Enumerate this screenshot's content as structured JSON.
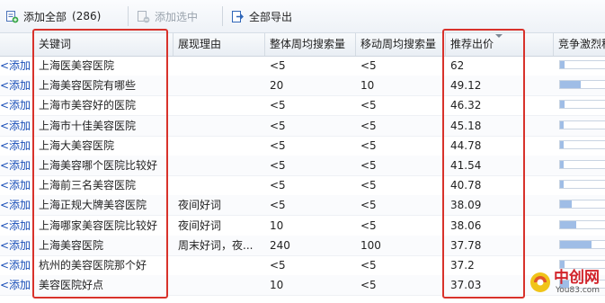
{
  "toolbar": {
    "add_all_label": "添加全部",
    "add_all_count": "(286)",
    "add_selected_label": "添加选中",
    "export_all_label": "全部导出"
  },
  "columns": {
    "keyword": "关键词",
    "reason": "展现理由",
    "overall_search": "整体周均搜索量",
    "mobile_search": "移动周均搜索量",
    "bid": "推荐出价",
    "competition": "竞争激烈程"
  },
  "add_link_text": "<添加",
  "rows": [
    {
      "keyword": "上海医美容医院",
      "reason": "",
      "overall": "<5",
      "mobile": "<5",
      "bid": "62",
      "competition": 0.1
    },
    {
      "keyword": "上海美容医院有哪些",
      "reason": "",
      "overall": "20",
      "mobile": "10",
      "bid": "49.12",
      "competition": 0.45
    },
    {
      "keyword": "上海市美容好的医院",
      "reason": "",
      "overall": "<5",
      "mobile": "<5",
      "bid": "46.32",
      "competition": 0.1
    },
    {
      "keyword": "上海市十佳美容医院",
      "reason": "",
      "overall": "<5",
      "mobile": "<5",
      "bid": "45.18",
      "competition": 0.08
    },
    {
      "keyword": "上海大美容医院",
      "reason": "",
      "overall": "<5",
      "mobile": "<5",
      "bid": "44.78",
      "competition": 0.08
    },
    {
      "keyword": "上海美容哪个医院比较好",
      "reason": "",
      "overall": "<5",
      "mobile": "<5",
      "bid": "41.54",
      "competition": 0.08
    },
    {
      "keyword": "上海前三名美容医院",
      "reason": "",
      "overall": "<5",
      "mobile": "<5",
      "bid": "40.78",
      "competition": 0.08
    },
    {
      "keyword": "上海正规大牌美容医院",
      "reason": "夜间好词",
      "overall": "<5",
      "mobile": "<5",
      "bid": "38.09",
      "competition": 0.25
    },
    {
      "keyword": "上海哪家美容医院比较好",
      "reason": "夜间好词",
      "overall": "10",
      "mobile": "<5",
      "bid": "38.06",
      "competition": 0.35
    },
    {
      "keyword": "上海美容医院",
      "reason": "周末好词，夜...",
      "overall": "240",
      "mobile": "100",
      "bid": "37.78",
      "competition": 0.7
    },
    {
      "keyword": "杭州的美容医院那个好",
      "reason": "",
      "overall": "<5",
      "mobile": "<5",
      "bid": "37.2",
      "competition": 0.1
    },
    {
      "keyword": "美容医院好点",
      "reason": "",
      "overall": "10",
      "mobile": "<5",
      "bid": "37.03",
      "competition": 0.2
    }
  ],
  "colors": {
    "highlight": "#d8322b",
    "link": "#1a4fb8",
    "bar": "#9fbde6"
  },
  "logo": {
    "brand_text": "中创网",
    "site_text": "You83.com"
  }
}
